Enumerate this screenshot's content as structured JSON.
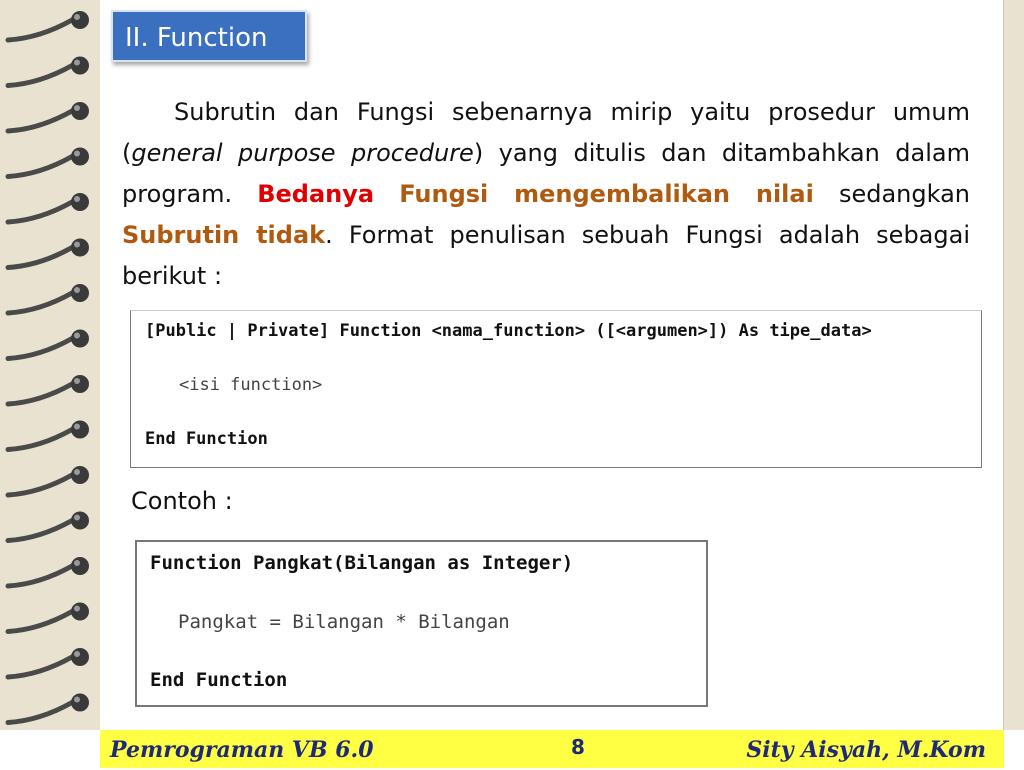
{
  "slide": {
    "title": "II. Function",
    "para": {
      "t1": "Subrutin dan Fungsi sebenarnya mirip yaitu prosedur umum (",
      "t2_italic": "general purpose procedure",
      "t3": ") yang ditulis dan ditambahkan dalam program. ",
      "t4_red": "Bedanya",
      "t5": " ",
      "t6_brown": "Fungsi mengembalikan nilai",
      "t7": " sedangkan ",
      "t8_brown": "Subrutin tidak",
      "t9": ". Format penulisan sebuah Fungsi adalah sebagai berikut :"
    },
    "format_code": {
      "line1": "[Public | Private] Function <nama_function> ([<argumen>]) As tipe_data>",
      "line2": "<isi function>",
      "line3": "End Function"
    },
    "contoh_label": "Contoh :",
    "example_code": {
      "line1": "Function Pangkat(Bilangan as Integer)",
      "line2": "Pangkat = Bilangan * Bilangan",
      "line3": "End Function"
    }
  },
  "footer": {
    "left": "Pemrograman  VB 6.0",
    "page": "8",
    "right": "Sity Aisyah, M.Kom"
  },
  "colors": {
    "title_bg": "#3b6fbf",
    "highlight_red": "#e00000",
    "highlight_brown": "#b05a10",
    "footer_bg": "#ffff44",
    "footer_text": "#1e2a78"
  }
}
